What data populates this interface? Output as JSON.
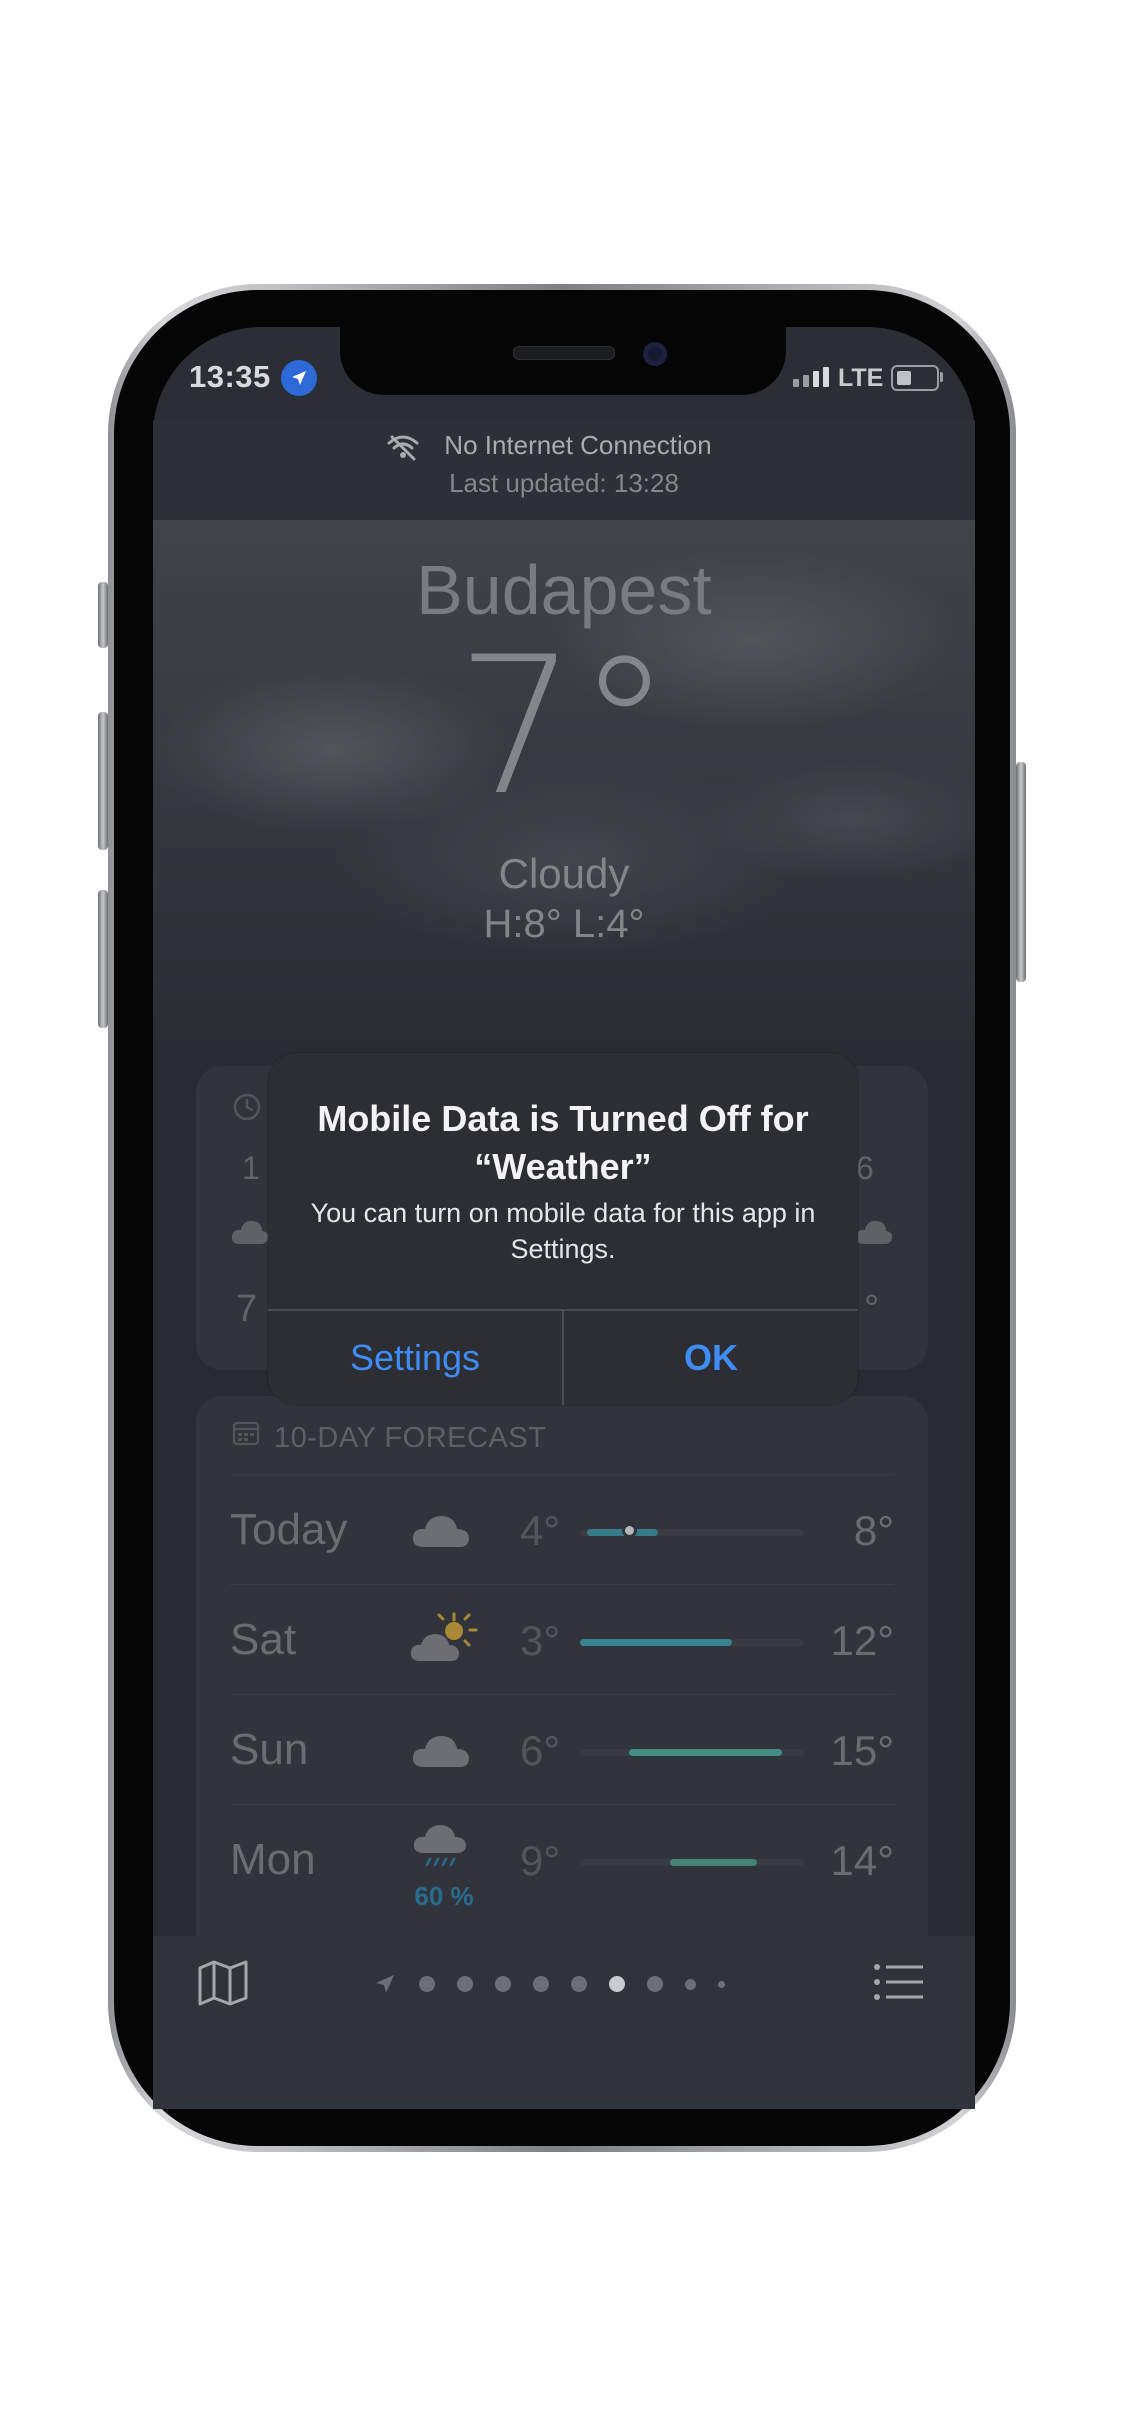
{
  "status_bar": {
    "time": "13:35",
    "network": "LTE"
  },
  "offline_banner": {
    "title": "No Internet Connection",
    "subtitle": "Last updated: 13:28"
  },
  "current": {
    "city": "Budapest",
    "temperature": "7°",
    "condition": "Cloudy",
    "high_low": "H:8°  L:4°"
  },
  "hourly_partial": {
    "left_hour": "1",
    "right_hour": "6",
    "left_temp": "7",
    "right_temp": "°"
  },
  "daily_forecast": {
    "header": "10-DAY FORECAST",
    "days": [
      {
        "day": "Today",
        "icon": "cloud-icon",
        "low": "4°",
        "high": "8°",
        "precip": "",
        "bar_start": 0.03,
        "bar_end": 0.35,
        "current_marker": 0.22,
        "bar_color": "#3e8fa0"
      },
      {
        "day": "Sat",
        "icon": "partly-sunny-icon",
        "low": "3°",
        "high": "12°",
        "precip": "",
        "bar_start": 0.0,
        "bar_end": 0.68,
        "bar_color": "#3d9aa8"
      },
      {
        "day": "Sun",
        "icon": "cloud-icon",
        "low": "6°",
        "high": "15°",
        "precip": "",
        "bar_start": 0.22,
        "bar_end": 0.9,
        "bar_color": "#4fa89a"
      },
      {
        "day": "Mon",
        "icon": "rain-cloud-icon",
        "low": "9°",
        "high": "14°",
        "precip": "60 %",
        "bar_start": 0.4,
        "bar_end": 0.79,
        "bar_color": "#4d9c88"
      }
    ]
  },
  "alert": {
    "title": "Mobile Data is Turned Off for “Weather”",
    "message": "You can turn on mobile data for this app in Settings.",
    "settings_label": "Settings",
    "ok_label": "OK"
  },
  "page_indicator": {
    "count": 9,
    "active_index": 5
  },
  "colors": {
    "accent": "#3f8cf4",
    "background": "#2b2f35"
  }
}
